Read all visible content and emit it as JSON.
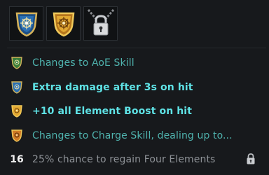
{
  "slots": [
    {
      "icon": "blue-crest-icon",
      "locked": false
    },
    {
      "icon": "gold-crest-icon",
      "locked": false
    },
    {
      "icon": "padlock-chain-icon",
      "locked": true
    }
  ],
  "effects": [
    {
      "icon": "green-crest-icon",
      "text": "Changes to AoE Skill"
    },
    {
      "icon": "blue-crest-icon",
      "text": "Extra damage after 3s on hit"
    },
    {
      "icon": "gold-crest-icon",
      "text": "+10 all Element Boost on hit"
    },
    {
      "icon": "orange-crest-icon",
      "text": "Changes to Charge Skill, dealing up to..."
    },
    {
      "level": "16",
      "text": "25% chance to regain Four Elements",
      "locked": true
    }
  ],
  "colors": {
    "background": "#17191c",
    "inactive_text": "#4fb3ae",
    "active_text": "#5fe3e6",
    "locked_text": "#8d9196"
  }
}
